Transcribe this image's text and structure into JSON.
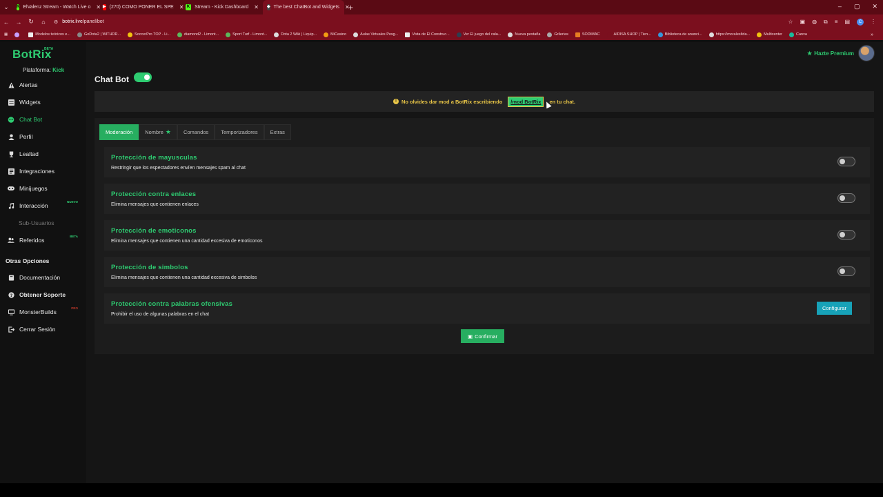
{
  "browser": {
    "tabs": [
      {
        "label": "ElValenz Stream - Watch Live o",
        "fav": "K",
        "favcolor": "#53fc18"
      },
      {
        "label": "(270) COMO PONER EL SPE",
        "fav": "▶",
        "favcolor": "#ff0000"
      },
      {
        "label": "Stream - Kick Dashboard",
        "fav": "K",
        "favcolor": "#53fc18"
      },
      {
        "label": "The best ChatBot and Widgets",
        "fav": "◆",
        "favcolor": "#bbbbbb"
      }
    ],
    "new_tab": "+",
    "url_host": "botrix.live",
    "url_path": "/panel/bot",
    "bookmarks": [
      {
        "label": "Modelos teóricos e..."
      },
      {
        "label": "GoDota2 | WITHDR..."
      },
      {
        "label": "SoccerPro TOP - Li..."
      },
      {
        "label": "diamond2 - Limont..."
      },
      {
        "label": "Sport Turf - Limont..."
      },
      {
        "label": "Dota 2 Wiki | Liquip..."
      },
      {
        "label": "MiCasino"
      },
      {
        "label": "Aulas Virtuales Posg..."
      },
      {
        "label": "Vista de El Construc..."
      },
      {
        "label": "Ver El juego del cala..."
      },
      {
        "label": "Nueva pestaña"
      },
      {
        "label": "Grilerias"
      },
      {
        "label": "SODIMAC"
      },
      {
        "label": "AIDISA SHOP | Tien..."
      },
      {
        "label": "Biblioteca de anunci..."
      },
      {
        "label": "https://moralesltda..."
      },
      {
        "label": "Multicenter"
      },
      {
        "label": "Canva"
      }
    ]
  },
  "brand": {
    "name": "BotRix",
    "tag": "BETA"
  },
  "platform": {
    "label": "Plataforma:",
    "value": "Kick"
  },
  "sidebar": {
    "items": [
      {
        "label": "Alertas",
        "icon": "alert-icon"
      },
      {
        "label": "Widgets",
        "icon": "widgets-icon"
      },
      {
        "label": "Chat Bot",
        "icon": "chatbot-icon"
      },
      {
        "label": "Perfil",
        "icon": "profile-icon"
      },
      {
        "label": "Lealtad",
        "icon": "trophy-icon"
      },
      {
        "label": "Integraciones",
        "icon": "integrations-icon"
      },
      {
        "label": "Minijuegos",
        "icon": "gamepad-icon"
      },
      {
        "label": "Interacción",
        "icon": "music-icon",
        "badge": "NUEVO"
      },
      {
        "label": "Sub-Usuarios",
        "icon": ""
      },
      {
        "label": "Referidos",
        "icon": "users-icon",
        "badge": "BETA"
      }
    ],
    "section_title": "Otras Opciones",
    "other": [
      {
        "label": "Documentación",
        "icon": "book-icon"
      },
      {
        "label": "Obtener Soporte",
        "icon": "help-icon"
      },
      {
        "label": "MonsterBuilds",
        "icon": "monitor-icon",
        "badge": "PRO"
      },
      {
        "label": "Cerrar Sesión",
        "icon": "logout-icon"
      }
    ]
  },
  "header": {
    "premium_label": "Hazte Premium"
  },
  "page": {
    "title": "Chat Bot",
    "bot_enabled": true,
    "notice_before": "No olvides dar mod a BotRix escribiendo",
    "notice_code": "/mod BotRix",
    "notice_after": "en tu chat."
  },
  "tabs": [
    "Moderación",
    "Nombre",
    "Comandos",
    "Temporizadores",
    "Extras"
  ],
  "settings": [
    {
      "title": "Protección de mayusculas",
      "desc": "Restringir que los espectadores envíen mensajes spam al chat",
      "enabled": false
    },
    {
      "title": "Protección contra enlaces",
      "desc": "Elimina mensajes que contienen enlaces",
      "enabled": false
    },
    {
      "title": "Protección de emoticonos",
      "desc": "Elimina mensajes que contienen una cantidad excesiva de emoticonos",
      "enabled": false
    },
    {
      "title": "Protección de simbolos",
      "desc": "Elimina mensajes que contienen una cantidad excesiva de simbolos",
      "enabled": false
    },
    {
      "title": "Protección contra palabras ofensivas",
      "desc": "Prohibir el uso de algunas palabras en el chat",
      "action_label": "Configurar"
    }
  ],
  "confirm_label": "Confirmar",
  "colors": {
    "accent": "#2ecc71",
    "chrome": "#7b0f1e",
    "info_button": "#17a2b8",
    "notice_text": "#e8c547"
  }
}
